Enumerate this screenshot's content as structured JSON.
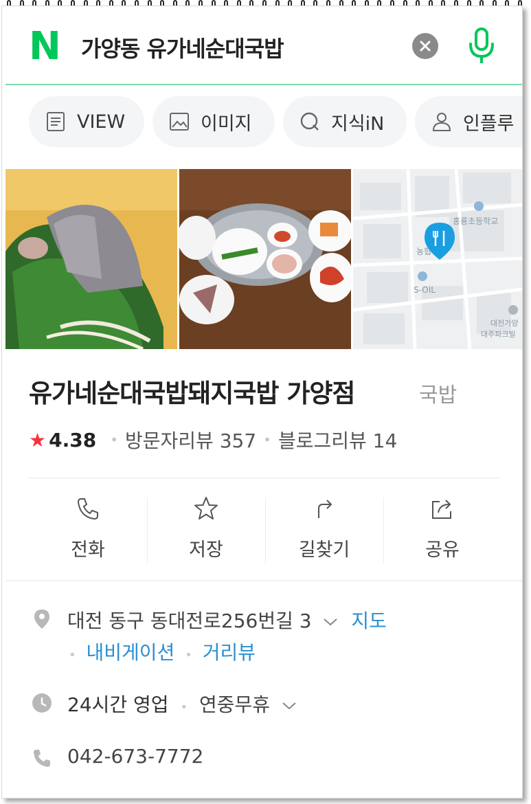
{
  "search": {
    "logo": "N",
    "query": "가양동 유가네순대국밥",
    "clear_icon": "close-icon",
    "mic_icon": "microphone-icon",
    "accent_color": "#03c75a"
  },
  "tabs": [
    {
      "label": "VIEW",
      "icon": "document-icon"
    },
    {
      "label": "이미지",
      "icon": "image-icon"
    },
    {
      "label": "지식iN",
      "icon": "q-icon"
    },
    {
      "label": "인플루",
      "icon": "person-icon"
    }
  ],
  "map": {
    "labels": [
      "홍룡초등학교",
      "농협",
      "S-OIL",
      "대전가양",
      "대주파크빌"
    ]
  },
  "place": {
    "name": "유가네순대국밥돼지국밥 가양점",
    "category": "국밥",
    "rating": "4.38",
    "visitor_reviews": "방문자리뷰 357",
    "blog_reviews": "블로그리뷰 14",
    "star_color": "#f5333f"
  },
  "actions": [
    {
      "label": "전화",
      "icon": "phone-icon"
    },
    {
      "label": "저장",
      "icon": "star-icon"
    },
    {
      "label": "길찾기",
      "icon": "directions-icon"
    },
    {
      "label": "공유",
      "icon": "share-icon"
    }
  ],
  "info": {
    "address": "대전 동구 동대전로256번길 3",
    "map_link": "지도",
    "navigation_link": "내비게이션",
    "street_view_link": "거리뷰",
    "hours": "24시간 영업",
    "holiday": "연중무휴",
    "phone": "042-673-7772",
    "link_color": "#2a8fd1"
  }
}
